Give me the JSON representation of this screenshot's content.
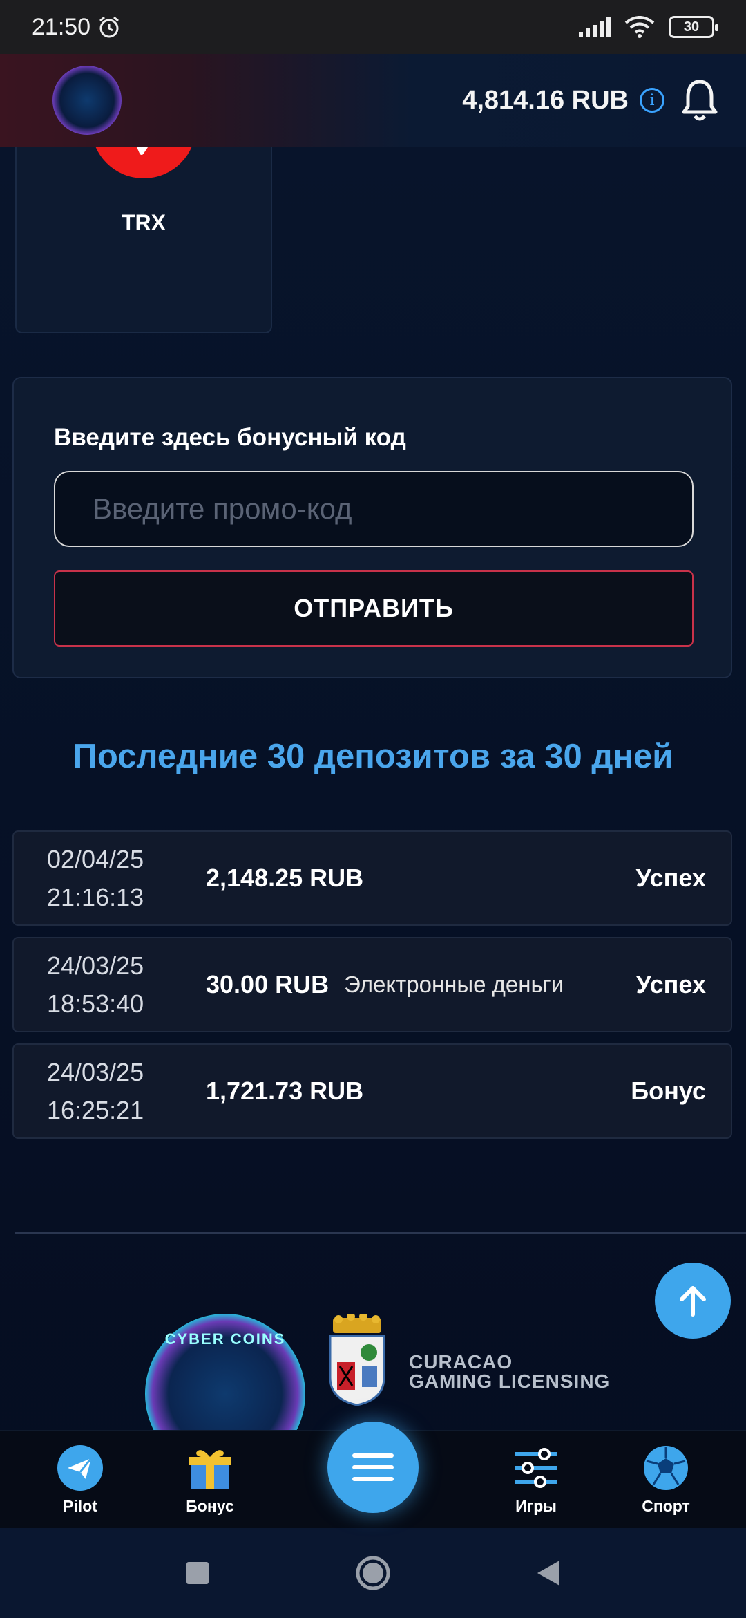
{
  "status_bar": {
    "time": "21:50",
    "battery": "30"
  },
  "header": {
    "balance": "4,814.16 RUB",
    "info_glyph": "i"
  },
  "payment_method": {
    "label": "TRX"
  },
  "promo": {
    "title": "Введите здесь бонусный код",
    "placeholder": "Введите промо-код",
    "value": "",
    "submit_label": "ОТПРАВИТЬ"
  },
  "deposits": {
    "title": "Последние 30 депозитов за 30 дней",
    "rows": [
      {
        "date": "02/04/25",
        "time": "21:16:13",
        "amount": "2,148.25 RUB",
        "method": "",
        "status": "Успех"
      },
      {
        "date": "24/03/25",
        "time": "18:53:40",
        "amount": "30.00 RUB",
        "method": "Электронные деньги",
        "status": "Успех"
      },
      {
        "date": "24/03/25",
        "time": "16:25:21",
        "amount": "1,721.73 RUB",
        "method": "",
        "status": "Бонус"
      }
    ]
  },
  "footer": {
    "logo_text": "CYBER COINS",
    "license_line1": "CURACAO",
    "license_line2": "GAMING LICENSING"
  },
  "bottom_nav": {
    "items": [
      {
        "label": "Pilot",
        "icon": "paper-plane-icon"
      },
      {
        "label": "Бонус",
        "icon": "gift-icon"
      },
      {
        "label": "Игры",
        "icon": "sliders-icon"
      },
      {
        "label": "Спорт",
        "icon": "soccer-ball-icon"
      }
    ]
  },
  "colors": {
    "accent": "#3ea6ec",
    "trx_red": "#ef1b1b",
    "send_border": "#c8324a",
    "deposits_title": "#4aa6ec"
  }
}
